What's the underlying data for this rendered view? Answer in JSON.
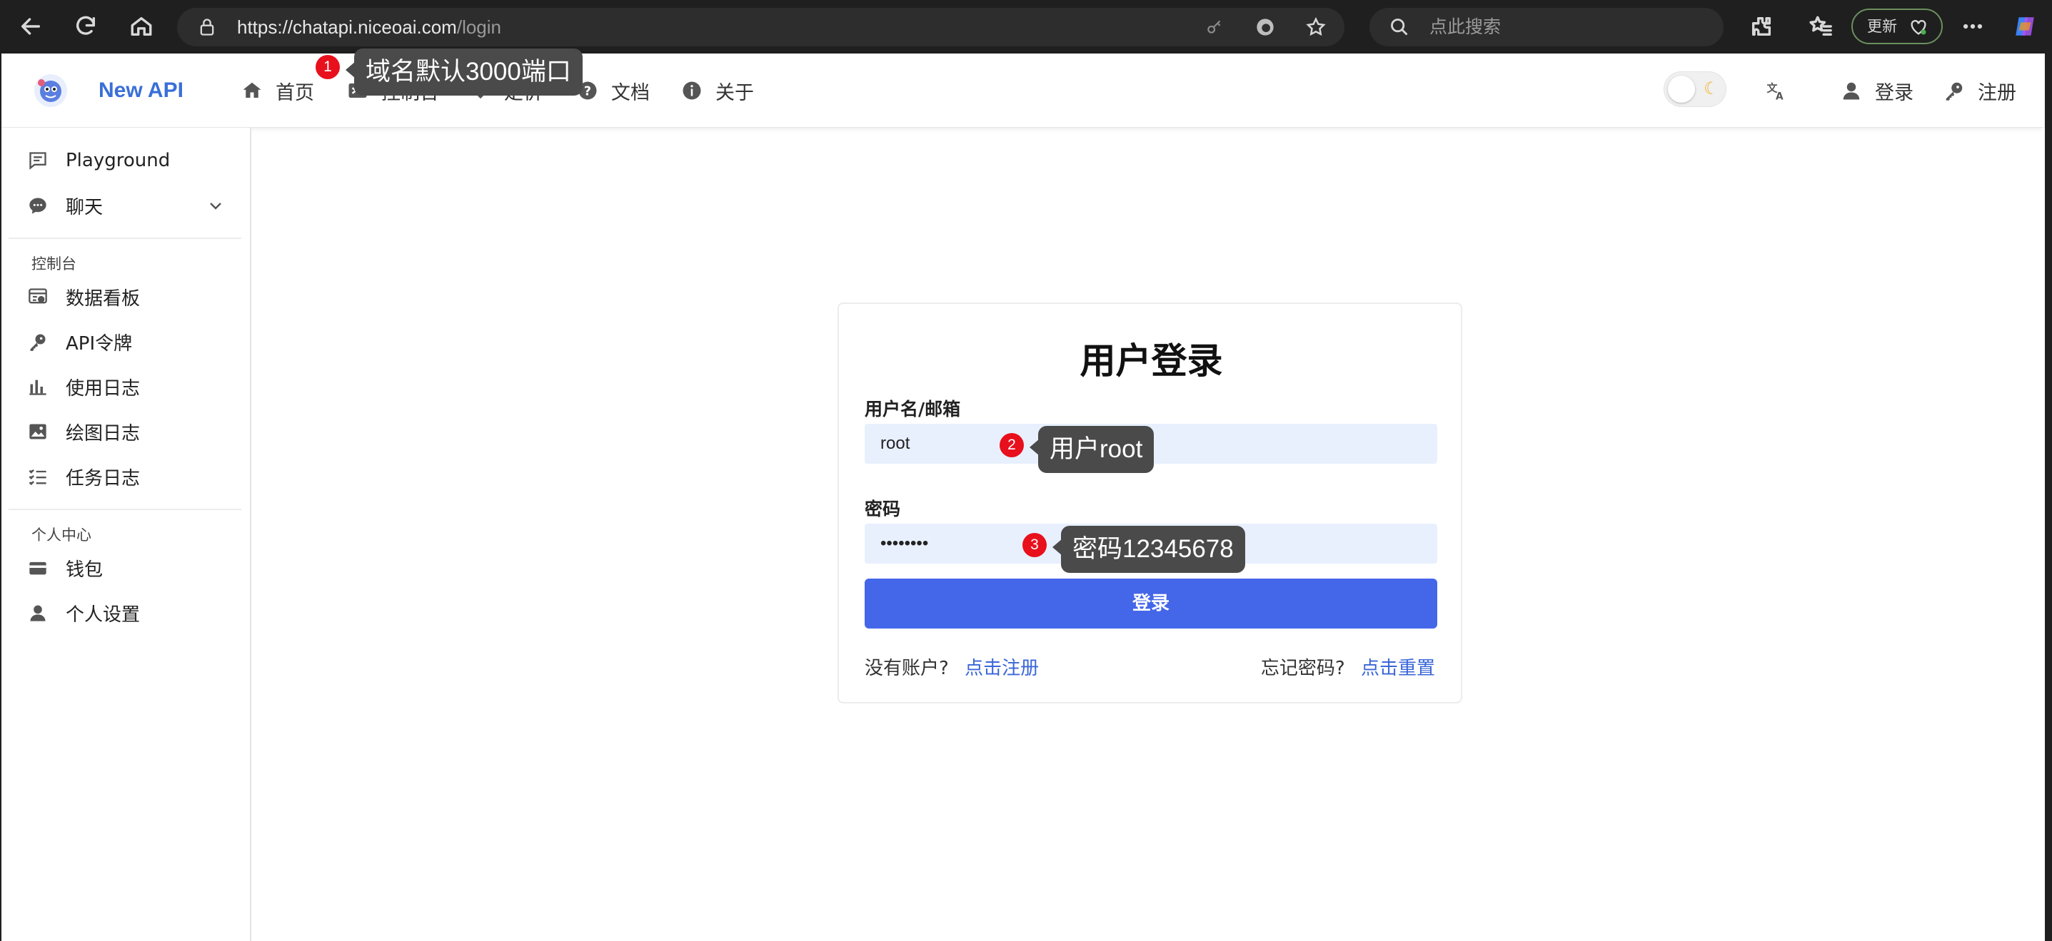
{
  "browser": {
    "url_host": "https://chatapi.niceoai.com",
    "url_path": "/login",
    "search_placeholder": "点此搜索",
    "update_label": "更新"
  },
  "app": {
    "title": "New API",
    "nav": [
      {
        "label": "首页",
        "icon": "home-icon"
      },
      {
        "label": "控制台",
        "icon": "console-icon"
      },
      {
        "label": "定价",
        "icon": "price-tag-icon"
      },
      {
        "label": "文档",
        "icon": "help-circle-icon"
      },
      {
        "label": "关于",
        "icon": "info-icon"
      }
    ],
    "header_right": {
      "login_label": "登录",
      "register_label": "注册"
    }
  },
  "sidebar": {
    "items_top": [
      {
        "label": "Playground",
        "icon": "chat-square-icon"
      },
      {
        "label": "聊天",
        "icon": "chat-bubble-icon"
      }
    ],
    "section_console": "控制台",
    "items_console": [
      {
        "label": "数据看板",
        "icon": "dashboard-icon"
      },
      {
        "label": "API令牌",
        "icon": "key-icon"
      },
      {
        "label": "使用日志",
        "icon": "bar-chart-icon"
      },
      {
        "label": "绘图日志",
        "icon": "image-icon"
      },
      {
        "label": "任务日志",
        "icon": "checklist-icon"
      }
    ],
    "section_personal": "个人中心",
    "items_personal": [
      {
        "label": "钱包",
        "icon": "wallet-icon"
      },
      {
        "label": "个人设置",
        "icon": "user-icon"
      }
    ]
  },
  "login": {
    "title": "用户登录",
    "username_label": "用户名/邮箱",
    "username_value": "root",
    "password_label": "密码",
    "password_value": "••••••••",
    "submit_label": "登录",
    "no_account_text": "没有账户?",
    "register_link": "点击注册",
    "forgot_text": "忘记密码?",
    "reset_link": "点击重置"
  },
  "annotations": [
    {
      "num": "1",
      "text": "域名默认3000端口"
    },
    {
      "num": "2",
      "text": "用户root"
    },
    {
      "num": "3",
      "text": "密码12345678"
    }
  ],
  "colors": {
    "accent": "#4466e8",
    "brand_text": "#3a6fd8",
    "badge": "#e8101c",
    "tooltip": "#4a4a4a"
  }
}
